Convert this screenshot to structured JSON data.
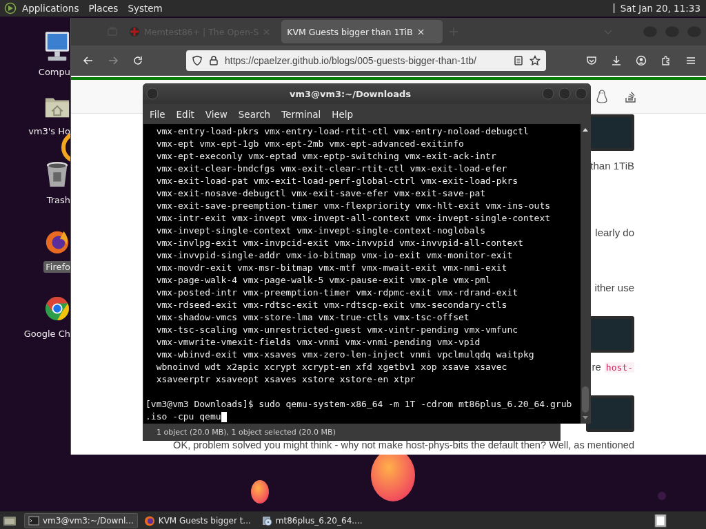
{
  "top_panel": {
    "menus": [
      "Applications",
      "Places",
      "System"
    ],
    "clock": "Sat Jan 20, 11:33"
  },
  "desktop_icons": [
    {
      "kind": "computer",
      "label": "Compu"
    },
    {
      "kind": "home",
      "label": "vm3's Ho"
    },
    {
      "kind": "trash",
      "label": "Trash"
    },
    {
      "kind": "firefox",
      "label": "Firefo",
      "selected": true
    },
    {
      "kind": "chrome",
      "label": "Google Ch",
      "selected": false
    }
  ],
  "browser": {
    "tabs": [
      {
        "title": "Memtest86+ | The Open-S",
        "selected": false
      },
      {
        "title": "KVM Guests bigger than 1TiB",
        "selected": true
      }
    ],
    "url": "https://cpaelzer.github.io/blogs/005-guests-bigger-than-1tb/",
    "page": [
      {
        "kind": "code"
      },
      {
        "kind": "text",
        "text": "than 1TiB"
      },
      {
        "kind": "text",
        "text": "learly do"
      },
      {
        "kind": "text",
        "text": "ither use"
      },
      {
        "kind": "code"
      },
      {
        "kind": "mixed",
        "text": "re",
        "code": "host-"
      },
      {
        "kind": "code"
      },
      {
        "kind": "paragraph",
        "text": "OK, problem solved you might think - why not make host-phys-bits the default then? Well, as mentioned"
      }
    ]
  },
  "terminal": {
    "title": "vm3@vm3:~/Downloads",
    "menus": [
      "File",
      "Edit",
      "View",
      "Search",
      "Terminal",
      "Help"
    ],
    "cursor": true,
    "lines": [
      {
        "kind": "output",
        "text": "vmx-entry-load-pkrs vmx-entry-load-rtit-ctl vmx-entry-noload-debugctl"
      },
      {
        "kind": "output",
        "text": "vmx-ept vmx-ept-1gb vmx-ept-2mb vmx-ept-advanced-exitinfo"
      },
      {
        "kind": "output",
        "text": "vmx-ept-execonly vmx-eptad vmx-eptp-switching vmx-exit-ack-intr"
      },
      {
        "kind": "output",
        "text": "vmx-exit-clear-bndcfgs vmx-exit-clear-rtit-ctl vmx-exit-load-efer"
      },
      {
        "kind": "output",
        "text": "vmx-exit-load-pat vmx-exit-load-perf-global-ctrl vmx-exit-load-pkrs"
      },
      {
        "kind": "output",
        "text": "vmx-exit-nosave-debugctl vmx-exit-save-efer vmx-exit-save-pat"
      },
      {
        "kind": "output",
        "text": "vmx-exit-save-preemption-timer vmx-flexpriority vmx-hlt-exit vmx-ins-outs"
      },
      {
        "kind": "output",
        "text": "vmx-intr-exit vmx-invept vmx-invept-all-context vmx-invept-single-context"
      },
      {
        "kind": "output",
        "text": "vmx-invept-single-context vmx-invept-single-context-noglobals"
      },
      {
        "kind": "output",
        "text": "vmx-invlpg-exit vmx-invpcid-exit vmx-invvpid vmx-invvpid-all-context"
      },
      {
        "kind": "output",
        "text": "vmx-invvpid-single-addr vmx-io-bitmap vmx-io-exit vmx-monitor-exit"
      },
      {
        "kind": "output",
        "text": "vmx-movdr-exit vmx-msr-bitmap vmx-mtf vmx-mwait-exit vmx-nmi-exit"
      },
      {
        "kind": "output",
        "text": "vmx-page-walk-4 vmx-page-walk-5 vmx-pause-exit vmx-ple vmx-pml"
      },
      {
        "kind": "output",
        "text": "vmx-posted-intr vmx-preemption-timer vmx-rdpmc-exit vmx-rdrand-exit"
      },
      {
        "kind": "output",
        "text": "vmx-rdseed-exit vmx-rdtsc-exit vmx-rdtscp-exit vmx-secondary-ctls"
      },
      {
        "kind": "output",
        "text": "vmx-shadow-vmcs vmx-store-lma vmx-true-ctls vmx-tsc-offset"
      },
      {
        "kind": "output",
        "text": "vmx-tsc-scaling vmx-unrestricted-guest vmx-vintr-pending vmx-vmfunc"
      },
      {
        "kind": "output",
        "text": "vmx-vmwrite-vmexit-fields vmx-vnmi vmx-vnmi-pending vmx-vpid"
      },
      {
        "kind": "output",
        "text": "vmx-wbinvd-exit vmx-xsaves vmx-zero-len-inject vnmi vpclmulqdq waitpkg"
      },
      {
        "kind": "output",
        "text": "wbnoinvd wdt x2apic xcrypt xcrypt-en xfd xgetbv1 xop xsave xsavec"
      },
      {
        "kind": "output",
        "text": "xsaveerptr xsaveopt xsaves xstore xstore-en xtpr"
      },
      {
        "kind": "blank"
      },
      {
        "kind": "command",
        "text": "[vm3@vm3 Downloads]$ sudo qemu-system-x86_64 -m 1T -cdrom mt86plus_6.20_64.grub"
      },
      {
        "kind": "command",
        "text": ".iso -cpu qemu"
      }
    ]
  },
  "file_manager_status": "1 object (20.0 MB), 1 object selected (20.0 MB)",
  "taskbar": [
    {
      "kind": "terminal",
      "title": "vm3@vm3:~/Downl...",
      "selected": true
    },
    {
      "kind": "firefox",
      "title": "KVM Guests bigger t...",
      "selected": false
    },
    {
      "kind": "disc",
      "title": "mt86plus_6.20_64....",
      "selected": false
    }
  ]
}
